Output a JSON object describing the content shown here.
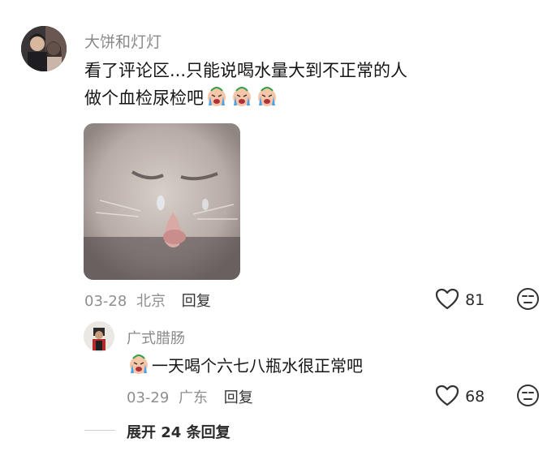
{
  "comment": {
    "username": "大饼和灯灯",
    "text_line1": "看了评论区...只能说喝水量大到不正常的人",
    "text_line2": "做个血检尿检吧",
    "emoji": "crying-face-emoji",
    "date": "03-28",
    "location": "北京",
    "reply_label": "回复",
    "likes": "81"
  },
  "reply": {
    "username": "广式腊肠",
    "text": "一天喝个六七八瓶水很正常吧",
    "emoji": "crying-face-emoji",
    "date": "03-29",
    "location": "广东",
    "reply_label": "回复",
    "likes": "68"
  },
  "expand": {
    "label": "展开 24 条回复"
  },
  "colors": {
    "meta_gray": "#8f8f8f",
    "text": "#161616"
  }
}
